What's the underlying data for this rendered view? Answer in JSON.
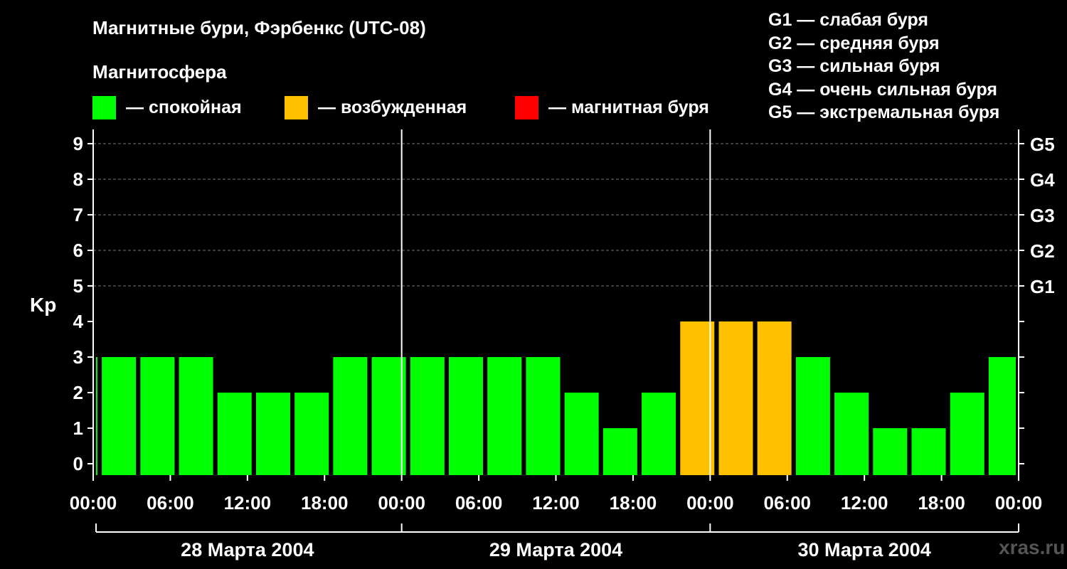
{
  "title": "Магнитные бури, Фэрбенкс (UTC-08)",
  "subtitle": "Магнитосфера",
  "legend": [
    {
      "label": "— спокойная",
      "color": "#00ff00"
    },
    {
      "label": "— возбужденная",
      "color": "#ffc000"
    },
    {
      "label": "— магнитная буря",
      "color": "#ff0000"
    }
  ],
  "storm_levels": [
    "G1 — слабая буря",
    "G2 — средняя буря",
    "G3 — сильная буря",
    "G4 — очень сильная буря",
    "G5 — экстремальная буря"
  ],
  "watermark": "xras.ru",
  "chart_data": {
    "type": "bar",
    "ylabel": "Kp",
    "ylim": [
      0,
      9
    ],
    "yticks": [
      "0",
      "1",
      "2",
      "3",
      "4",
      "5",
      "6",
      "7",
      "8",
      "9"
    ],
    "right_ticks": [
      {
        "value": 5,
        "label": "G1"
      },
      {
        "value": 6,
        "label": "G2"
      },
      {
        "value": 7,
        "label": "G3"
      },
      {
        "value": 8,
        "label": "G4"
      },
      {
        "value": 9,
        "label": "G5"
      }
    ],
    "grid": "horizontal dashed",
    "xticks": [
      "00:00",
      "06:00",
      "12:00",
      "18:00",
      "00:00",
      "06:00",
      "12:00",
      "18:00",
      "00:00",
      "06:00",
      "12:00",
      "18:00",
      "00:00"
    ],
    "days": [
      "28 Марта 2004",
      "29 Марта 2004",
      "30 Марта 2004"
    ],
    "bar_interval_hours": 3,
    "bar_offset_hours": -1,
    "values": [
      3,
      3,
      3,
      3,
      2,
      2,
      2,
      3,
      3,
      3,
      3,
      3,
      3,
      2,
      1,
      2,
      4,
      4,
      4,
      3,
      2,
      1,
      1,
      2,
      3
    ],
    "colors": {
      "quiet": "#00ff00",
      "active": "#ffc000",
      "storm": "#ff0000"
    }
  }
}
